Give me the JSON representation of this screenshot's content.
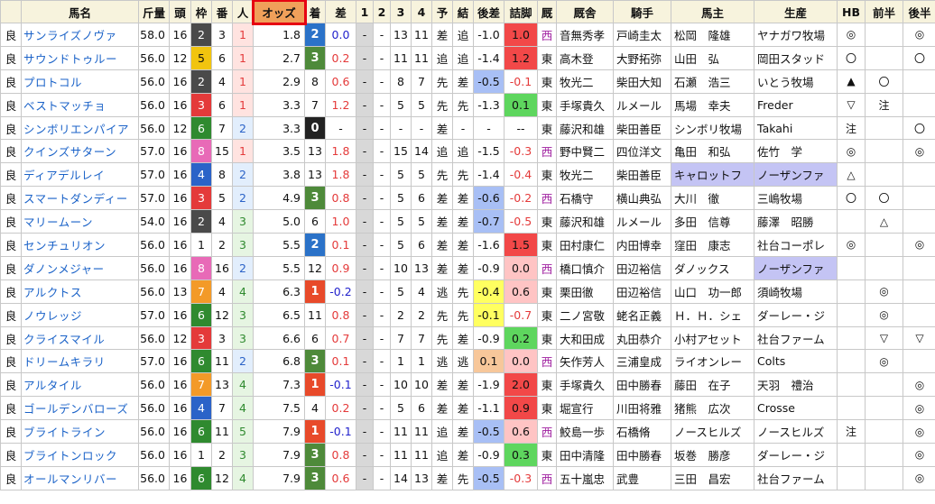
{
  "headers": [
    "",
    "馬名",
    "斤量",
    "頭",
    "枠",
    "番",
    "人",
    "オッズ",
    "着",
    "差",
    "1",
    "2",
    "3",
    "4",
    "予",
    "結",
    "後差",
    "詰脚",
    "厩",
    "厩舎",
    "騎手",
    "馬主",
    "生産",
    "HB",
    "前半",
    "後半"
  ],
  "rows": [
    {
      "cond": "良",
      "name": "サンライズノヴァ",
      "kin": "58.0",
      "tou": "16",
      "waku": "2",
      "ban": "3",
      "pop": "1",
      "odds": "1.8",
      "fin": "2",
      "sa": "0.0",
      "c1": "-",
      "c2": "-",
      "c3": "13",
      "c4": "11",
      "yo": "差",
      "ke": "追",
      "kousa": "-1.0",
      "tsume": "1.0",
      "ki": "西",
      "stable": "音無秀孝",
      "jockey": "戸崎圭太",
      "owner": "松岡　隆雄",
      "breeder": "ヤナガワ牧場",
      "hb": "◎",
      "zen": "",
      "kou": "◎"
    },
    {
      "cond": "良",
      "name": "サウンドトゥルー",
      "kin": "56.0",
      "tou": "12",
      "waku": "5",
      "ban": "6",
      "pop": "1",
      "odds": "2.7",
      "fin": "3",
      "sa": "0.2",
      "c1": "-",
      "c2": "-",
      "c3": "11",
      "c4": "11",
      "yo": "追",
      "ke": "追",
      "kousa": "-1.4",
      "tsume": "1.2",
      "ki": "東",
      "stable": "高木登",
      "jockey": "大野拓弥",
      "owner": "山田　弘",
      "breeder": "岡田スタッド",
      "hb": "〇",
      "zen": "",
      "kou": "〇"
    },
    {
      "cond": "良",
      "name": "プロトコル",
      "kin": "56.0",
      "tou": "16",
      "waku": "2",
      "ban": "4",
      "pop": "1",
      "odds": "2.9",
      "fin": "8",
      "sa": "0.6",
      "c1": "-",
      "c2": "-",
      "c3": "8",
      "c4": "7",
      "yo": "先",
      "ke": "差",
      "kousa": "-0.5",
      "tsume": "-0.1",
      "ki": "東",
      "stable": "牧光二",
      "jockey": "柴田大知",
      "owner": "石瀬　浩三",
      "breeder": "いとう牧場",
      "hb": "▲",
      "zen": "〇",
      "kou": ""
    },
    {
      "cond": "良",
      "name": "ベストマッチョ",
      "kin": "56.0",
      "tou": "16",
      "waku": "3",
      "ban": "6",
      "pop": "1",
      "odds": "3.3",
      "fin": "7",
      "sa": "1.2",
      "c1": "-",
      "c2": "-",
      "c3": "5",
      "c4": "5",
      "yo": "先",
      "ke": "先",
      "kousa": "-1.3",
      "tsume": "0.1",
      "ki": "東",
      "stable": "手塚貴久",
      "jockey": "ルメール",
      "owner": "馬場　幸夫",
      "breeder": "Freder",
      "hb": "▽",
      "zen": "注",
      "kou": ""
    },
    {
      "cond": "良",
      "name": "シンボリエンパイア",
      "kin": "56.0",
      "tou": "12",
      "waku": "6",
      "ban": "7",
      "pop": "2",
      "odds": "3.3",
      "fin": "0",
      "sa": "-",
      "c1": "-",
      "c2": "-",
      "c3": "-",
      "c4": "-",
      "yo": "差",
      "ke": "-",
      "kousa": "-",
      "tsume": "--",
      "ki": "東",
      "stable": "藤沢和雄",
      "jockey": "柴田善臣",
      "owner": "シンボリ牧場",
      "breeder": "Takahi",
      "hb": "注",
      "zen": "",
      "kou": "〇"
    },
    {
      "cond": "良",
      "name": "クインズサターン",
      "kin": "57.0",
      "tou": "16",
      "waku": "8",
      "ban": "15",
      "pop": "1",
      "odds": "3.5",
      "fin": "13",
      "sa": "1.8",
      "c1": "-",
      "c2": "-",
      "c3": "15",
      "c4": "14",
      "yo": "追",
      "ke": "追",
      "kousa": "-1.5",
      "tsume": "-0.3",
      "ki": "西",
      "stable": "野中賢二",
      "jockey": "四位洋文",
      "owner": "亀田　和弘",
      "breeder": "佐竹　学",
      "hb": "◎",
      "zen": "",
      "kou": "◎"
    },
    {
      "cond": "良",
      "name": "ディアデルレイ",
      "kin": "57.0",
      "tou": "16",
      "waku": "4",
      "ban": "8",
      "pop": "2",
      "odds": "3.8",
      "fin": "13",
      "sa": "1.8",
      "c1": "-",
      "c2": "-",
      "c3": "5",
      "c4": "5",
      "yo": "先",
      "ke": "先",
      "kousa": "-1.4",
      "tsume": "-0.4",
      "ki": "東",
      "stable": "牧光二",
      "jockey": "柴田善臣",
      "owner": "キャロットフ",
      "breeder": "ノーザンファ",
      "hb": "△",
      "zen": "",
      "kou": ""
    },
    {
      "cond": "良",
      "name": "スマートダンディー",
      "kin": "57.0",
      "tou": "16",
      "waku": "3",
      "ban": "5",
      "pop": "2",
      "odds": "4.9",
      "fin": "3",
      "sa": "0.8",
      "c1": "-",
      "c2": "-",
      "c3": "5",
      "c4": "6",
      "yo": "差",
      "ke": "差",
      "kousa": "-0.6",
      "tsume": "-0.2",
      "ki": "西",
      "stable": "石橋守",
      "jockey": "横山典弘",
      "owner": "大川　徹",
      "breeder": "三嶋牧場",
      "hb": "〇",
      "zen": "〇",
      "kou": ""
    },
    {
      "cond": "良",
      "name": "マリームーン",
      "kin": "54.0",
      "tou": "16",
      "waku": "2",
      "ban": "4",
      "pop": "3",
      "odds": "5.0",
      "fin": "6",
      "sa": "1.0",
      "c1": "-",
      "c2": "-",
      "c3": "5",
      "c4": "5",
      "yo": "差",
      "ke": "差",
      "kousa": "-0.7",
      "tsume": "-0.5",
      "ki": "東",
      "stable": "藤沢和雄",
      "jockey": "ルメール",
      "owner": "多田　信尊",
      "breeder": "藤澤　昭勝",
      "hb": "",
      "zen": "△",
      "kou": ""
    },
    {
      "cond": "良",
      "name": "センチュリオン",
      "kin": "56.0",
      "tou": "16",
      "waku": "1",
      "ban": "2",
      "pop": "3",
      "odds": "5.5",
      "fin": "2",
      "sa": "0.1",
      "c1": "-",
      "c2": "-",
      "c3": "5",
      "c4": "6",
      "yo": "差",
      "ke": "差",
      "kousa": "-1.6",
      "tsume": "1.5",
      "ki": "東",
      "stable": "田村康仁",
      "jockey": "内田博幸",
      "owner": "窪田　康志",
      "breeder": "社台コーポレ",
      "hb": "◎",
      "zen": "",
      "kou": "◎"
    },
    {
      "cond": "良",
      "name": "ダノンメジャー",
      "kin": "56.0",
      "tou": "16",
      "waku": "8",
      "ban": "16",
      "pop": "2",
      "odds": "5.5",
      "fin": "12",
      "sa": "0.9",
      "c1": "-",
      "c2": "-",
      "c3": "10",
      "c4": "13",
      "yo": "差",
      "ke": "差",
      "kousa": "-0.9",
      "tsume": "0.0",
      "ki": "西",
      "stable": "橋口慎介",
      "jockey": "田辺裕信",
      "owner": "ダノックス",
      "breeder": "ノーザンファ",
      "hb": "",
      "zen": "",
      "kou": ""
    },
    {
      "cond": "良",
      "name": "アルクトス",
      "kin": "56.0",
      "tou": "13",
      "waku": "7",
      "ban": "4",
      "pop": "4",
      "odds": "6.3",
      "fin": "1",
      "sa": "-0.2",
      "c1": "-",
      "c2": "-",
      "c3": "5",
      "c4": "4",
      "yo": "逃",
      "ke": "先",
      "kousa": "-0.4",
      "tsume": "0.6",
      "ki": "東",
      "stable": "栗田徹",
      "jockey": "田辺裕信",
      "owner": "山口　功一郎",
      "breeder": "須崎牧場",
      "hb": "",
      "zen": "◎",
      "kou": ""
    },
    {
      "cond": "良",
      "name": "ノウレッジ",
      "kin": "57.0",
      "tou": "16",
      "waku": "6",
      "ban": "12",
      "pop": "3",
      "odds": "6.5",
      "fin": "11",
      "sa": "0.8",
      "c1": "-",
      "c2": "-",
      "c3": "2",
      "c4": "2",
      "yo": "先",
      "ke": "先",
      "kousa": "-0.1",
      "tsume": "-0.7",
      "ki": "東",
      "stable": "二ノ宮敬",
      "jockey": "蛯名正義",
      "owner": "Ｈ．Ｈ．シェ",
      "breeder": "ダーレー・ジ",
      "hb": "",
      "zen": "◎",
      "kou": ""
    },
    {
      "cond": "良",
      "name": "クライスマイル",
      "kin": "56.0",
      "tou": "12",
      "waku": "3",
      "ban": "3",
      "pop": "3",
      "odds": "6.6",
      "fin": "6",
      "sa": "0.7",
      "c1": "-",
      "c2": "-",
      "c3": "7",
      "c4": "7",
      "yo": "先",
      "ke": "差",
      "kousa": "-0.9",
      "tsume": "0.2",
      "ki": "東",
      "stable": "大和田成",
      "jockey": "丸田恭介",
      "owner": "小村アセット",
      "breeder": "社台ファーム",
      "hb": "",
      "zen": "▽",
      "kou": "▽"
    },
    {
      "cond": "良",
      "name": "ドリームキラリ",
      "kin": "57.0",
      "tou": "16",
      "waku": "6",
      "ban": "11",
      "pop": "2",
      "odds": "6.8",
      "fin": "3",
      "sa": "0.1",
      "c1": "-",
      "c2": "-",
      "c3": "1",
      "c4": "1",
      "yo": "逃",
      "ke": "逃",
      "kousa": "0.1",
      "tsume": "0.0",
      "ki": "西",
      "stable": "矢作芳人",
      "jockey": "三浦皇成",
      "owner": "ライオンレー",
      "breeder": "Colts",
      "hb": "",
      "zen": "◎",
      "kou": ""
    },
    {
      "cond": "良",
      "name": "アルタイル",
      "kin": "56.0",
      "tou": "16",
      "waku": "7",
      "ban": "13",
      "pop": "4",
      "odds": "7.3",
      "fin": "1",
      "sa": "-0.1",
      "c1": "-",
      "c2": "-",
      "c3": "10",
      "c4": "10",
      "yo": "差",
      "ke": "差",
      "kousa": "-1.9",
      "tsume": "2.0",
      "ki": "東",
      "stable": "手塚貴久",
      "jockey": "田中勝春",
      "owner": "藤田　在子",
      "breeder": "天羽　禮治",
      "hb": "",
      "zen": "",
      "kou": "◎"
    },
    {
      "cond": "良",
      "name": "ゴールデンバローズ",
      "kin": "56.0",
      "tou": "16",
      "waku": "4",
      "ban": "7",
      "pop": "4",
      "odds": "7.5",
      "fin": "4",
      "sa": "0.2",
      "c1": "-",
      "c2": "-",
      "c3": "5",
      "c4": "6",
      "yo": "差",
      "ke": "差",
      "kousa": "-1.1",
      "tsume": "0.9",
      "ki": "東",
      "stable": "堀宣行",
      "jockey": "川田将雅",
      "owner": "猪熊　広次",
      "breeder": "Crosse",
      "hb": "",
      "zen": "",
      "kou": "◎"
    },
    {
      "cond": "良",
      "name": "ブライトライン",
      "kin": "56.0",
      "tou": "16",
      "waku": "6",
      "ban": "11",
      "pop": "5",
      "odds": "7.9",
      "fin": "1",
      "sa": "-0.1",
      "c1": "-",
      "c2": "-",
      "c3": "11",
      "c4": "11",
      "yo": "追",
      "ke": "差",
      "kousa": "-0.5",
      "tsume": "0.6",
      "ki": "西",
      "stable": "鮫島一歩",
      "jockey": "石橋脩",
      "owner": "ノースヒルズ",
      "breeder": "ノースヒルズ",
      "hb": "注",
      "zen": "",
      "kou": "◎"
    },
    {
      "cond": "良",
      "name": "ブライトンロック",
      "kin": "56.0",
      "tou": "16",
      "waku": "1",
      "ban": "2",
      "pop": "3",
      "odds": "7.9",
      "fin": "3",
      "sa": "0.8",
      "c1": "-",
      "c2": "-",
      "c3": "11",
      "c4": "11",
      "yo": "追",
      "ke": "差",
      "kousa": "-0.9",
      "tsume": "0.3",
      "ki": "東",
      "stable": "田中清隆",
      "jockey": "田中勝春",
      "owner": "坂巻　勝彦",
      "breeder": "ダーレー・ジ",
      "hb": "",
      "zen": "",
      "kou": "◎"
    },
    {
      "cond": "良",
      "name": "オールマンリバー",
      "kin": "56.0",
      "tou": "16",
      "waku": "6",
      "ban": "12",
      "pop": "4",
      "odds": "7.9",
      "fin": "3",
      "sa": "0.6",
      "c1": "-",
      "c2": "-",
      "c3": "14",
      "c4": "13",
      "yo": "差",
      "ke": "先",
      "kousa": "-0.5",
      "tsume": "-0.3",
      "ki": "西",
      "stable": "五十嵐忠",
      "jockey": "武豊",
      "owner": "三田　昌宏",
      "breeder": "社台ファーム",
      "hb": "",
      "zen": "",
      "kou": "◎"
    }
  ]
}
